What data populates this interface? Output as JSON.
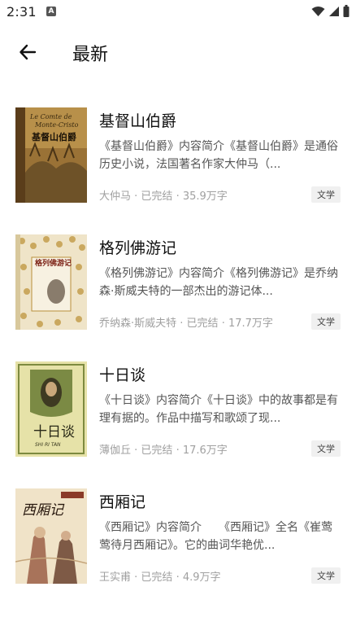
{
  "status_bar": {
    "time": "2:31",
    "app_icon_letter": "A"
  },
  "app_bar": {
    "title": "最新"
  },
  "books": [
    {
      "title": "基督山伯爵",
      "description": "《基督山伯爵》内容简介《基督山伯爵》是通俗历史小说，法国著名作家大仲马（...",
      "author": "大仲马",
      "status": "已完结",
      "word_count": "35.9万字",
      "tag": "文学",
      "cover_text": "基督山伯爵",
      "cover_colors": [
        "#7a5a2c",
        "#c9a55a"
      ]
    },
    {
      "title": "格列佛游记",
      "description": "《格列佛游记》内容简介《格列佛游记》是乔纳森·斯威夫特的一部杰出的游记体...",
      "author": "乔纳森·斯威夫特",
      "status": "已完结",
      "word_count": "17.7万字",
      "tag": "文学",
      "cover_text": "格列佛游记",
      "cover_colors": [
        "#efe7d3",
        "#c9a24e"
      ]
    },
    {
      "title": "十日谈",
      "description": "《十日谈》内容简介《十日谈》中的故事都是有理有据的。作品中描写和歌颂了现...",
      "author": "薄伽丘",
      "status": "已完结",
      "word_count": "17.6万字",
      "tag": "文学",
      "cover_text": "十日谈",
      "cover_subtext": "SHI RI TAN",
      "cover_colors": [
        "#e8e4ac",
        "#6d7d3a"
      ]
    },
    {
      "title": "西厢记",
      "description": "《西厢记》内容简介　　《西厢记》全名《崔莺莺待月西厢记》。它的曲词华艳优...",
      "author": "王实甫",
      "status": "已完结",
      "word_count": "4.9万字",
      "tag": "文学",
      "cover_text": "西厢记",
      "cover_colors": [
        "#f2e6cf",
        "#9b6a48"
      ]
    }
  ]
}
